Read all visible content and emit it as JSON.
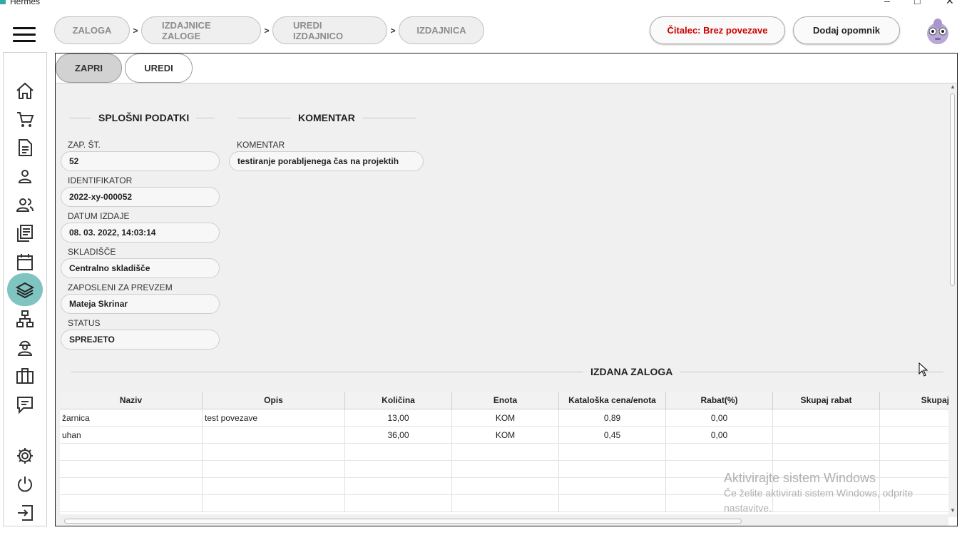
{
  "window": {
    "title": "Hermes",
    "minimize": "–",
    "maximize": "□",
    "close": "✕"
  },
  "breadcrumb": [
    {
      "label": "ZALOGA"
    },
    {
      "label": "IZDAJNICE ZALOGE"
    },
    {
      "label": "UREDI IZDAJNICO"
    },
    {
      "label": "IZDAJNICA"
    }
  ],
  "breadcrumb_separator": ">",
  "header": {
    "reader_label": "Čitalec: Brez povezave",
    "reminder_label": "Dodaj opomnik"
  },
  "sidebar": {
    "items": [
      {
        "icon": "home-icon"
      },
      {
        "icon": "cart-icon"
      },
      {
        "icon": "document-icon"
      },
      {
        "icon": "user-icon"
      },
      {
        "icon": "users-icon"
      },
      {
        "icon": "articles-icon"
      },
      {
        "icon": "calendar-icon"
      },
      {
        "icon": "layers-icon",
        "active": true
      },
      {
        "icon": "network-icon"
      },
      {
        "icon": "worker-icon"
      },
      {
        "icon": "briefcase-icon"
      },
      {
        "icon": "chat-icon"
      },
      {
        "icon": "gear-icon"
      },
      {
        "icon": "power-icon"
      },
      {
        "icon": "logout-icon"
      }
    ],
    "active_color": "#7fc4c0"
  },
  "actions": {
    "close_label": "ZAPRI",
    "edit_label": "UREDI"
  },
  "general": {
    "title": "SPLOŠNI PODATKI",
    "fields": [
      {
        "label": "ZAP. ŠT.",
        "value": "52"
      },
      {
        "label": "IDENTIFIKATOR",
        "value": "2022-xy-000052"
      },
      {
        "label": "DATUM IZDAJE",
        "value": "08. 03. 2022, 14:03:14"
      },
      {
        "label": "SKLADIŠČE",
        "value": "Centralno skladišče"
      },
      {
        "label": "ZAPOSLENI ZA PREVZEM",
        "value": "Mateja Skrinar"
      },
      {
        "label": "STATUS",
        "value": "SPREJETO"
      }
    ]
  },
  "comment": {
    "title": "KOMENTAR",
    "label": "KOMENTAR",
    "value": "testiranje porabljenega čas na projektih"
  },
  "issued": {
    "title": "IZDANA ZALOGA",
    "columns": [
      "Naziv",
      "Opis",
      "Količina",
      "Enota",
      "Kataloška cena/enota",
      "Rabat(%)",
      "Skupaj rabat",
      "Skupaj"
    ],
    "rows": [
      [
        "žarnica",
        "test povezave",
        "13,00",
        "KOM",
        "0,89",
        "0,00",
        "",
        ""
      ],
      [
        "uhan",
        "",
        "36,00",
        "KOM",
        "0,45",
        "0,00",
        "",
        ""
      ],
      [
        "",
        "",
        "",
        "",
        "",
        "",
        "",
        ""
      ],
      [
        "",
        "",
        "",
        "",
        "",
        "",
        "",
        ""
      ],
      [
        "",
        "",
        "",
        "",
        "",
        "",
        "",
        ""
      ],
      [
        "",
        "",
        "",
        "",
        "",
        "",
        "",
        ""
      ]
    ]
  },
  "watermark": {
    "title": "Aktivirajte sistem Windows",
    "subtitle": "Če želite aktivirati sistem Windows, odprite nastavitve."
  }
}
